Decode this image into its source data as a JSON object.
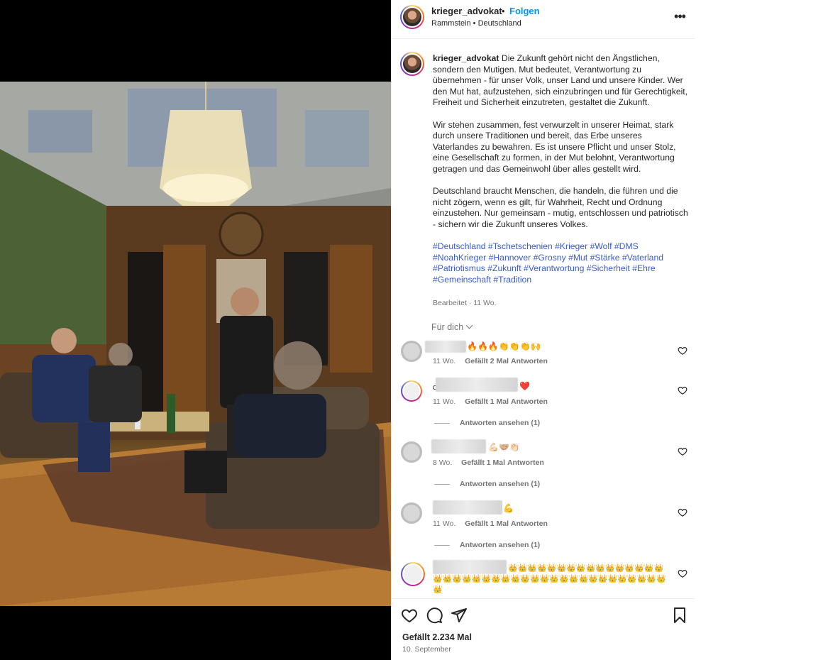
{
  "post": {
    "username": "krieger_advokat",
    "separator": "•",
    "follow_label": "Folgen",
    "location": "Rammstein • Deutschland",
    "more_label": "•••"
  },
  "caption": {
    "username": "krieger_advokat",
    "paragraph1": "Die Zukunft gehört nicht den Ängstlichen, sondern den Mutigen. Mut bedeutet, Verantwortung zu übernehmen - für unser Volk, unser Land und unsere Kinder. Wer den Mut hat, aufzustehen, sich einzubringen und für Gerechtigkeit, Freiheit und Sicherheit einzutreten, gestaltet die Zukunft.",
    "paragraph2": "Wir stehen zusammen, fest verwurzelt in unserer Heimat, stark durch unsere Traditionen und bereit, das Erbe unseres Vaterlandes zu bewahren. Es ist unsere Pflicht und unser Stolz, eine Gesellschaft zu formen, in der Mut belohnt, Verantwortung getragen und das Gemeinwohl über alles gestellt wird.",
    "paragraph3": "Deutschland braucht Menschen, die handeln, die führen und die nicht zögern, wenn es gilt, für Wahrheit, Recht und Ordnung einzustehen. Nur gemeinsam - mutig, entschlossen und patriotisch - sichern wir die Zukunft unseres Volkes.",
    "hashtags": [
      "#Deutschland",
      "#Tschetschenien",
      "#Krieger",
      "#Wolf",
      "#DMS",
      "#NoahKrieger",
      "#Hannover",
      "#Grosny",
      "#Mut",
      "#Stärke",
      "#Vaterland",
      "#Patriotismus",
      "#Zukunft",
      "#Verantwortung",
      "#Sicherheit",
      "#Ehre",
      "#Gemeinschaft",
      "#Tradition"
    ],
    "edited": "Bearbeitet · 11 Wo."
  },
  "comments_filter": "Für dich",
  "comments": [
    {
      "text": "🔥🔥🔥👏👏👏🙌",
      "time": "11 Wo.",
      "likes": "Gefällt 2 Mal",
      "reply": "Antworten",
      "view_replies": ""
    },
    {
      "text": "❤️",
      "prefix": "c",
      "time": "11 Wo.",
      "likes": "Gefällt 1 Mal",
      "reply": "Antworten",
      "view_replies": "Antworten ansehen (1)"
    },
    {
      "text": "💪🏻🤝🏼👏🏻",
      "time": "8 Wo.",
      "likes": "Gefällt 1 Mal",
      "reply": "Antworten",
      "view_replies": "Antworten ansehen (1)"
    },
    {
      "text": "💪",
      "time": "11 Wo.",
      "likes": "Gefällt 1 Mal",
      "reply": "Antworten",
      "view_replies": "Antworten ansehen (1)"
    },
    {
      "text": "👑👑👑👑👑👑👑👑👑👑👑👑👑👑👑👑👑👑👑👑👑👑👑👑👑👑👑👑👑👑👑👑👑👑👑👑👑👑👑👑👑",
      "time": "",
      "likes": "",
      "reply": "",
      "view_replies": ""
    }
  ],
  "footer": {
    "likes": "Gefällt 2.234 Mal",
    "date": "10. September"
  },
  "colors": {
    "link": "#0095f6",
    "hashtag": "#3a5bd1",
    "muted": "#737373",
    "text": "#262626"
  }
}
